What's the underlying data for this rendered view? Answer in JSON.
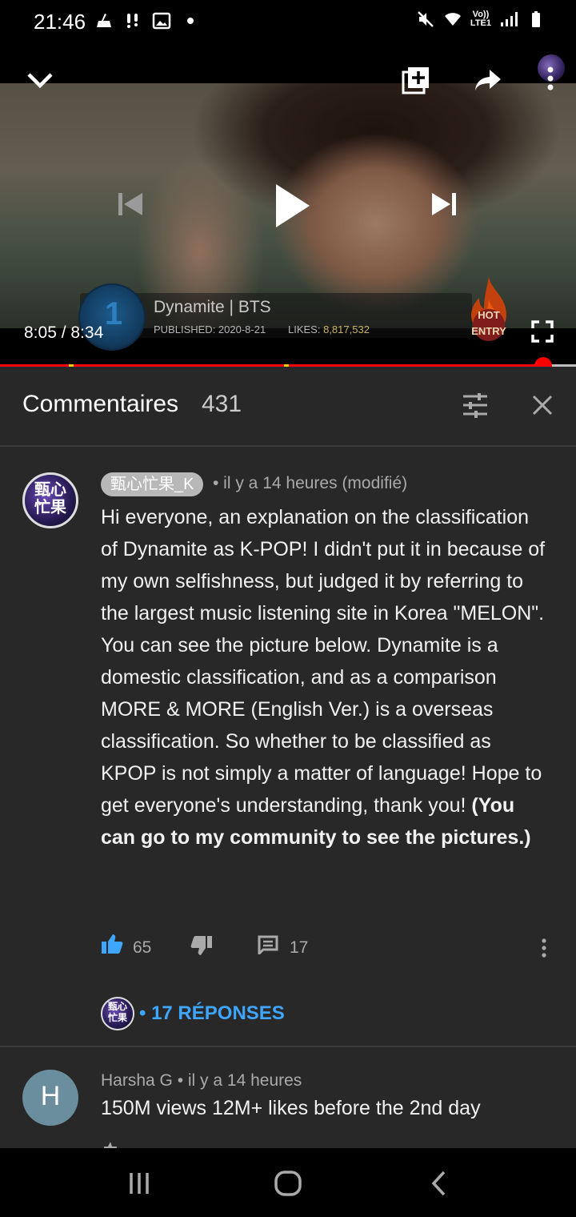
{
  "status_bar": {
    "time": "21:46",
    "network_label": "Vo))\nLTE1",
    "left_icons": [
      "sweep-icon",
      "alert-icon",
      "gallery-icon",
      "dot-icon"
    ],
    "right_icons": [
      "mute-icon",
      "wifi-icon",
      "lte-icon",
      "signal-icon",
      "battery-icon"
    ]
  },
  "player": {
    "overlay_rank": "1",
    "overlay_title": "Dynamite | BTS",
    "published_label": "PUBLISHED: 2020-8-21",
    "likes_label": "LIKES:",
    "likes_value": "8,817,532",
    "hot_badge_line1": "HOT",
    "hot_badge_line2": "ENTRY",
    "time": "8:05 / 8:34",
    "progress_fraction": 0.943,
    "accent_color": "#ff0000",
    "controls": [
      "chevron-down-icon",
      "add-to-queue-icon",
      "share-icon",
      "more-vert-icon",
      "skip-previous-icon",
      "play-icon",
      "skip-next-icon",
      "fullscreen-icon"
    ]
  },
  "comments_header": {
    "title": "Commentaires",
    "count": "431"
  },
  "comments": [
    {
      "author": "甄心忙果_K",
      "meta": "• il y a 14 heures (modifié)",
      "text_plain": "Hi everyone, an explanation on the classification of Dynamite as K-POP! I didn't put it in because of my own selfishness, but judged it by referring to the largest music listening site in Korea \"MELON\". You can see the picture below. Dynamite is a domestic classification, and as a comparison MORE & MORE (English Ver.) is a overseas classification. So whether to be classified as KPOP is not simply a matter of language! Hope to get everyone's understanding, thank you! ",
      "text_bold": "(You can go to my community to see the pictures.)",
      "text_end": "",
      "likes": "65",
      "replies": "17",
      "replies_link": "• 17 RÉPONSES",
      "avatar_glyph": "甄心忙果"
    },
    {
      "author": "Harsha G",
      "meta": "Harsha G • il y a 14 heures",
      "text": "150M views 12M+ likes before the 2nd day",
      "avatar_letter": "H",
      "avatar_color": "#6b8e9e"
    }
  ],
  "nav_bar": {
    "buttons": [
      "recents-icon",
      "home-icon",
      "back-icon"
    ]
  }
}
